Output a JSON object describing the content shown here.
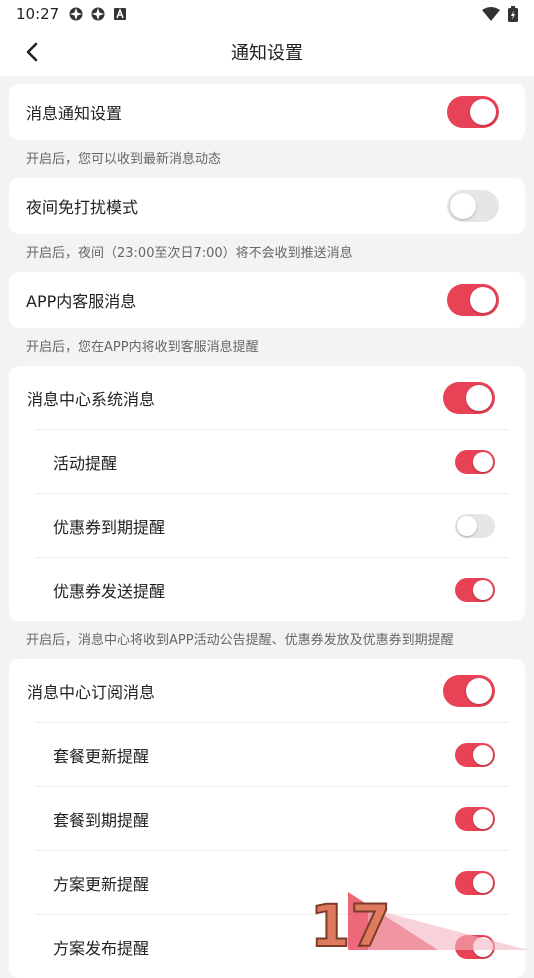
{
  "status_bar": {
    "time": "10:27"
  },
  "header": {
    "title": "通知设置"
  },
  "sections": [
    {
      "label": "消息通知设置",
      "on": true,
      "hint": "开启后，您可以收到最新消息动态"
    },
    {
      "label": "夜间免打扰模式",
      "on": false,
      "hint": "开启后，夜间（23:00至次日7:00）将不会收到推送消息"
    },
    {
      "label": "APP内客服消息",
      "on": true,
      "hint": "开启后，您在APP内将收到客服消息提醒"
    },
    {
      "label": "消息中心系统消息",
      "on": true,
      "items": [
        {
          "label": "活动提醒",
          "on": true
        },
        {
          "label": "优惠券到期提醒",
          "on": false
        },
        {
          "label": "优惠券发送提醒",
          "on": true
        }
      ],
      "hint": "开启后，消息中心将收到APP活动公告提醒、优惠券发放及优惠券到期提醒"
    },
    {
      "label": "消息中心订阅消息",
      "on": true,
      "items": [
        {
          "label": "套餐更新提醒",
          "on": true
        },
        {
          "label": "套餐到期提醒",
          "on": true
        },
        {
          "label": "方案更新提醒",
          "on": true
        },
        {
          "label": "方案发布提醒",
          "on": true
        }
      ]
    }
  ],
  "watermark": {
    "text": "17"
  },
  "colors": {
    "accent": "#e84257",
    "off": "#e6e6e6",
    "background": "#f3f3f3"
  }
}
